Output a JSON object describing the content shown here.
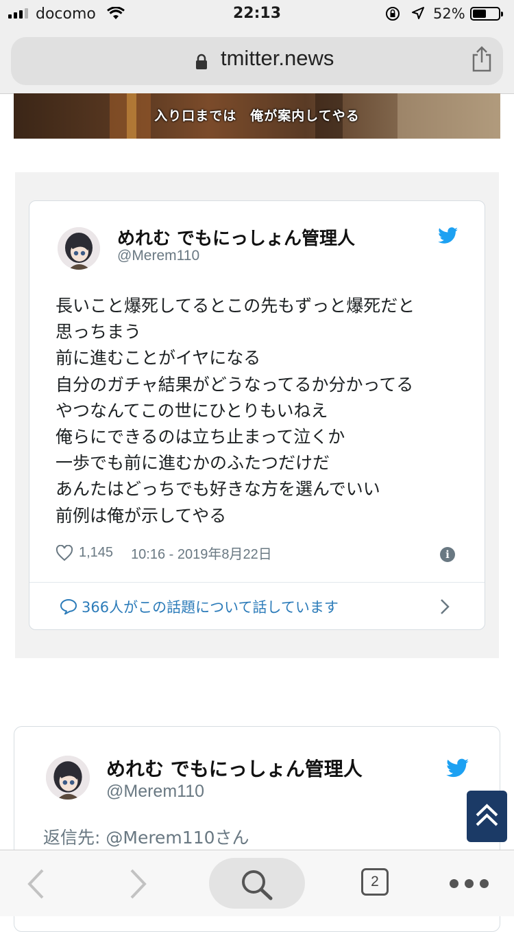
{
  "status_bar": {
    "carrier": "docomo",
    "time": "22:13",
    "battery": "52%",
    "battery_level": 0.52
  },
  "browser": {
    "url": "tmitter.news",
    "open_tabs": "2"
  },
  "banner": {
    "caption": "入り口までは　俺が案内してやる"
  },
  "tweet1": {
    "display_name": "めれむ でもにっしょん管理人",
    "handle": "@Merem110",
    "lines": [
      "長いこと爆死してるとこの先もずっと爆死だと",
      "思っちまう",
      "前に進むことがイヤになる",
      "自分のガチャ結果がどうなってるか分かってる",
      "やつなんてこの世にひとりもいねえ",
      "俺らにできるのは立ち止まって泣くか",
      "一歩でも前に進むかのふたつだけだ",
      "あんたはどっちでも好きな方を選んでいい",
      "前例は俺が示してやる"
    ],
    "likes": "1,145",
    "timestamp": "10:16 - 2019年8月22日",
    "conversation": "366人がこの話題について話しています"
  },
  "tweet2": {
    "display_name": "めれむ でもにっしょん管理人",
    "handle": "@Merem110",
    "reply_to": "返信先: @Merem110さん"
  },
  "colors": {
    "twitter_blue": "#1da1f2",
    "link_blue": "#2b7bb9",
    "scroll_button": "#1b3a66"
  },
  "icons": [
    "signal-icon",
    "wifi-icon",
    "orientation-lock-icon",
    "location-icon",
    "battery-icon",
    "lock-icon",
    "share-icon",
    "twitter-bird-icon",
    "heart-icon",
    "info-icon",
    "speech-bubble-icon",
    "chevron-right-icon",
    "double-chevron-up-icon",
    "back-icon",
    "forward-icon",
    "search-icon",
    "tabs-icon",
    "more-icon"
  ]
}
